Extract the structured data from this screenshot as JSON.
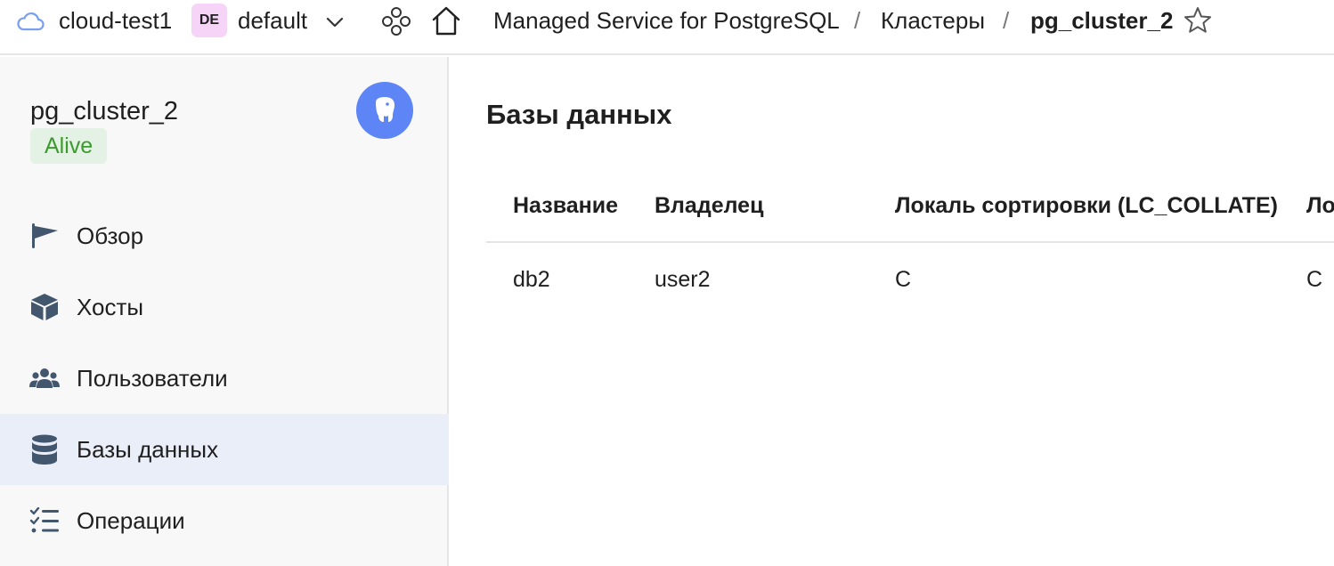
{
  "topbar": {
    "cloud_name": "cloud-test1",
    "folder_badge": "DE",
    "folder_name": "default",
    "breadcrumbs": [
      "Managed Service for PostgreSQL",
      "Кластеры",
      "pg_cluster_2"
    ],
    "separator": "/"
  },
  "sidebar": {
    "cluster_name": "pg_cluster_2",
    "status": "Alive",
    "nav": [
      {
        "label": "Обзор",
        "icon": "flag-icon",
        "active": false
      },
      {
        "label": "Хосты",
        "icon": "cube-icon",
        "active": false
      },
      {
        "label": "Пользователи",
        "icon": "users-icon",
        "active": false
      },
      {
        "label": "Базы данных",
        "icon": "database-icon",
        "active": true
      },
      {
        "label": "Операции",
        "icon": "checklist-icon",
        "active": false
      }
    ]
  },
  "main": {
    "title": "Базы данных",
    "table": {
      "columns": [
        "Название",
        "Владелец",
        "Локаль сортировки (LC_COLLATE)",
        "Ло"
      ],
      "rows": [
        [
          "db2",
          "user2",
          "C",
          "C"
        ]
      ]
    }
  },
  "colors": {
    "accent": "#5d85f5",
    "status_bg": "#e3f2e4",
    "status_text": "#3b9b2c",
    "folder_badge_bg": "#f6d4f7",
    "active_nav_bg": "#e9eef9"
  }
}
